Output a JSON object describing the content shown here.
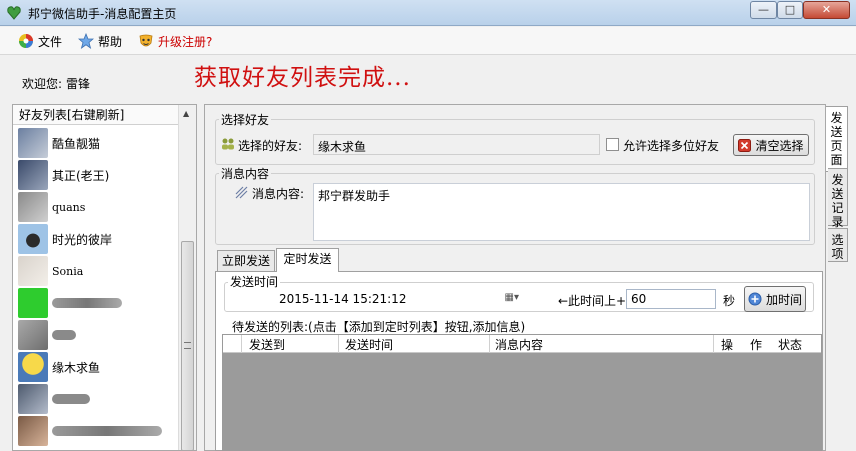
{
  "window": {
    "title": "邦宁微信助手-消息配置主页"
  },
  "menu": [
    {
      "label": "文件",
      "icon": "color-wheel-icon"
    },
    {
      "label": "帮助",
      "icon": "star-icon"
    },
    {
      "label": "升级注册?",
      "icon": "mask-icon",
      "color": "#cc0000"
    }
  ],
  "welcome": {
    "label": "欢迎您:",
    "name": "雷锋"
  },
  "status_message": "获取好友列表完成...",
  "friends": {
    "header": "好友列表[右键刷新]",
    "items": [
      {
        "name": "酷鱼靓猫"
      },
      {
        "name": "其正(老王)"
      },
      {
        "name": "quans"
      },
      {
        "name": "时光的彼岸"
      },
      {
        "name": "Sonia"
      },
      {
        "name": ""
      },
      {
        "name": ""
      },
      {
        "name": "缘木求鱼"
      },
      {
        "name": ""
      },
      {
        "name": ""
      }
    ]
  },
  "select_friend": {
    "group_title": "选择好友",
    "label": "选择的好友:",
    "value": "缘木求鱼",
    "allow_multi_label": "允许选择多位好友",
    "clear_button": "清空选择"
  },
  "message": {
    "group_title": "消息内容",
    "label": "消息内容:",
    "value": "邦宁群发助手"
  },
  "tabs": {
    "instant": "立即发送",
    "scheduled": "定时发送"
  },
  "schedule": {
    "group_title": "发送时间",
    "datetime": "2015-11-14 15:21:12",
    "offset_label": "←此时间上+",
    "offset_value": "60",
    "unit": "秒",
    "add_button": "加时间"
  },
  "pending": {
    "caption": "待发送的列表:(点击【添加到定时列表】按钮,添加信息)",
    "columns": [
      "发送到",
      "发送时间",
      "消息内容",
      "操",
      "作",
      "状态"
    ]
  },
  "side_tabs": [
    "发送页面",
    "发送记录",
    "选项"
  ]
}
